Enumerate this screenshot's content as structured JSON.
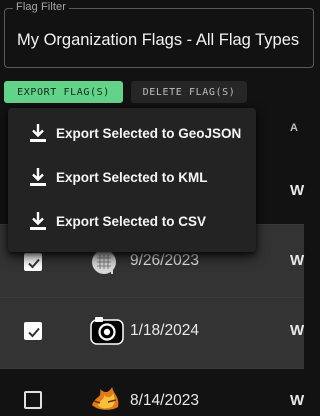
{
  "filter": {
    "legend": "Flag Filter",
    "value": "My Organization Flags - All Flag Types"
  },
  "toolbar": {
    "export_label": "EXPORT FLAG(S)",
    "delete_label": "DELETE FLAG(S)"
  },
  "export_menu": {
    "items": [
      {
        "label": "Export Selected to GeoJSON",
        "icon": "download-icon"
      },
      {
        "label": "Export Selected to KML",
        "icon": "download-icon"
      },
      {
        "label": "Export Selected to CSV",
        "icon": "download-icon"
      }
    ]
  },
  "table": {
    "header_partial": "A",
    "rows": [
      {
        "checked": false,
        "date": "",
        "col_partial": "W"
      },
      {
        "checked": true,
        "icon": "grid-map-icon",
        "date": "9/26/2023",
        "col_partial": "W"
      },
      {
        "checked": true,
        "icon": "camera-icon",
        "date": "1/18/2024",
        "col_partial": "W"
      },
      {
        "checked": false,
        "icon": "fire-icon",
        "date": "8/14/2023",
        "col_partial": "W"
      }
    ]
  },
  "colors": {
    "accent": "#64d38a",
    "background": "#121212",
    "row_selected": "#333333",
    "menu": "#232323"
  }
}
